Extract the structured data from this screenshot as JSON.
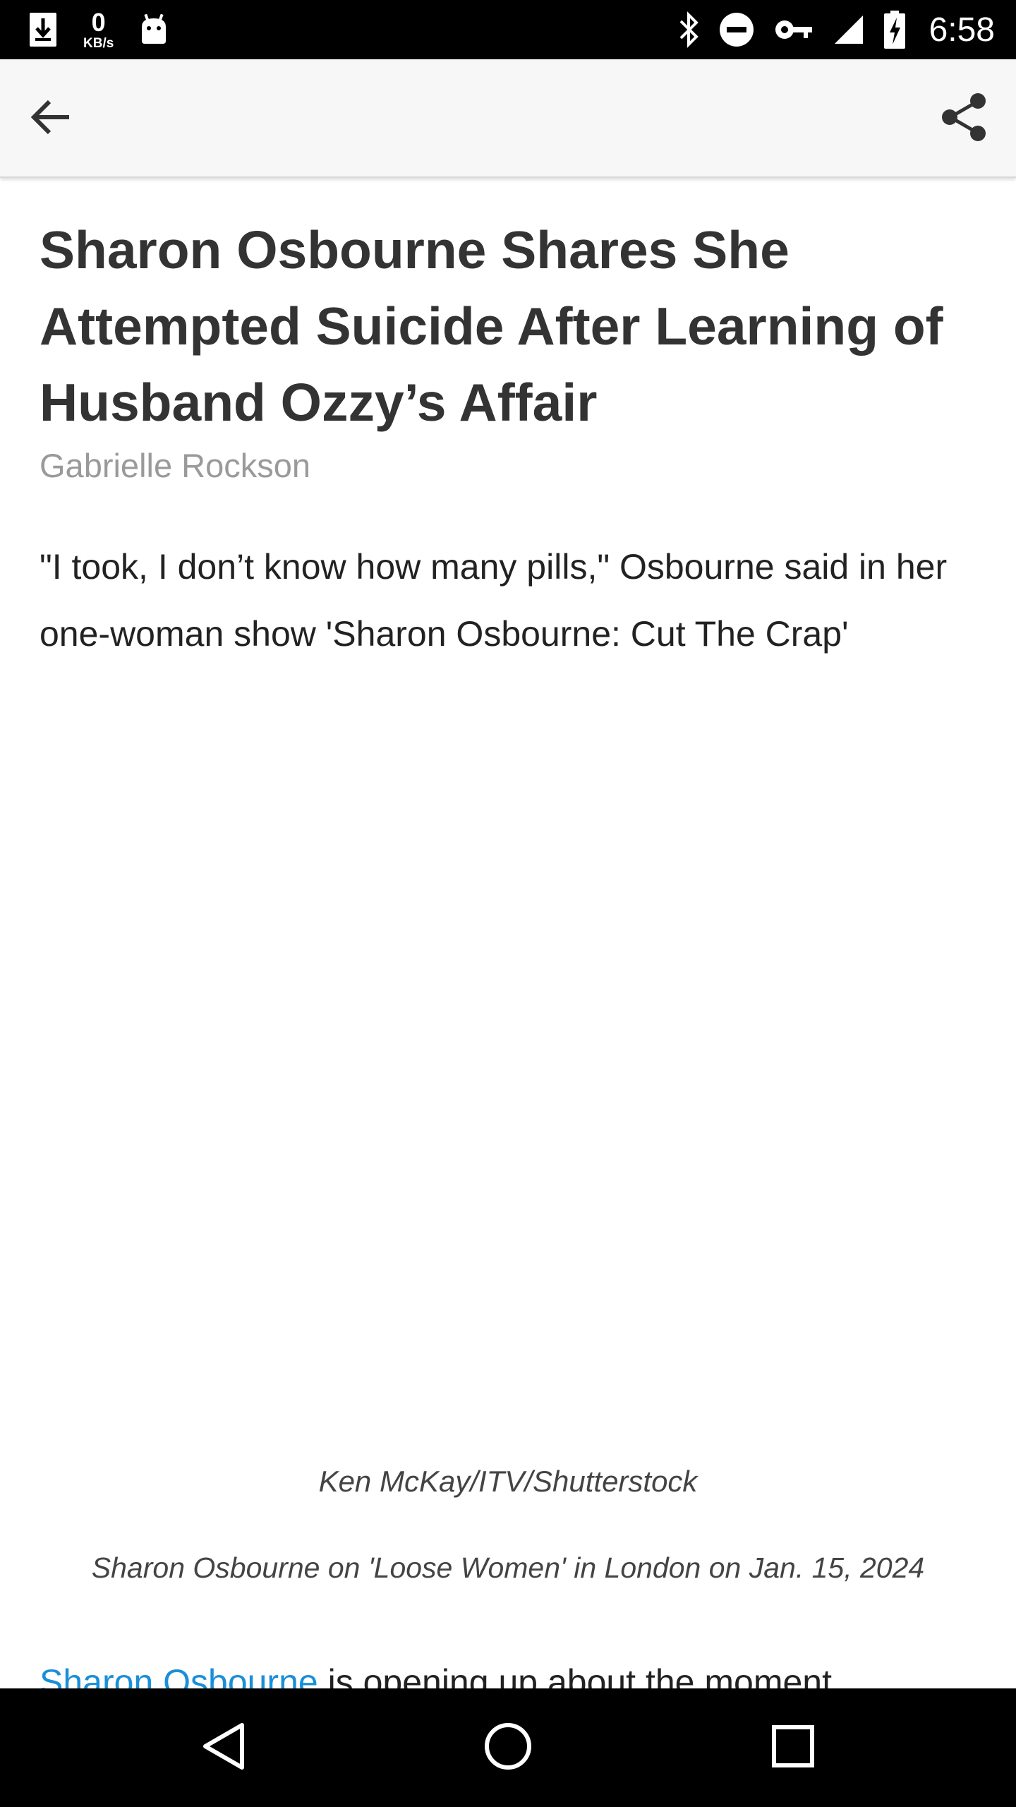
{
  "status_bar": {
    "speed_value": "0",
    "speed_unit": "KB/s",
    "time": "6:58",
    "icons": [
      "download-icon",
      "android-icon",
      "bluetooth-icon",
      "do-not-disturb-icon",
      "key-icon",
      "signal-icon",
      "battery-charging-icon"
    ]
  },
  "app_bar": {
    "icons": [
      "back-arrow-icon",
      "share-icon"
    ]
  },
  "article": {
    "headline": "Sharon Osbourne Shares She Attempted Suicide After Learning of Husband Ozzy’s Affair",
    "byline": "Gabrielle Rockson",
    "dek": "\"I took, I don’t know how many pills,\" Osbourne said in her one-woman show 'Sharon Osbourne: Cut The Crap'",
    "image_credit": "Ken McKay/ITV/Shutterstock",
    "image_caption": "Sharon Osbourne on 'Loose Women' in London on Jan. 15, 2024",
    "body_link": "Sharon Osbourne",
    "body_text": " is opening up about the moment"
  },
  "nav_bar": {
    "icons": [
      "nav-back-icon",
      "nav-home-icon",
      "nav-recents-icon"
    ]
  },
  "colors": {
    "link": "#1a8fd8",
    "byline": "#9a9a9a",
    "headline": "#333333",
    "app_bar_bg": "#f7f7f7"
  }
}
